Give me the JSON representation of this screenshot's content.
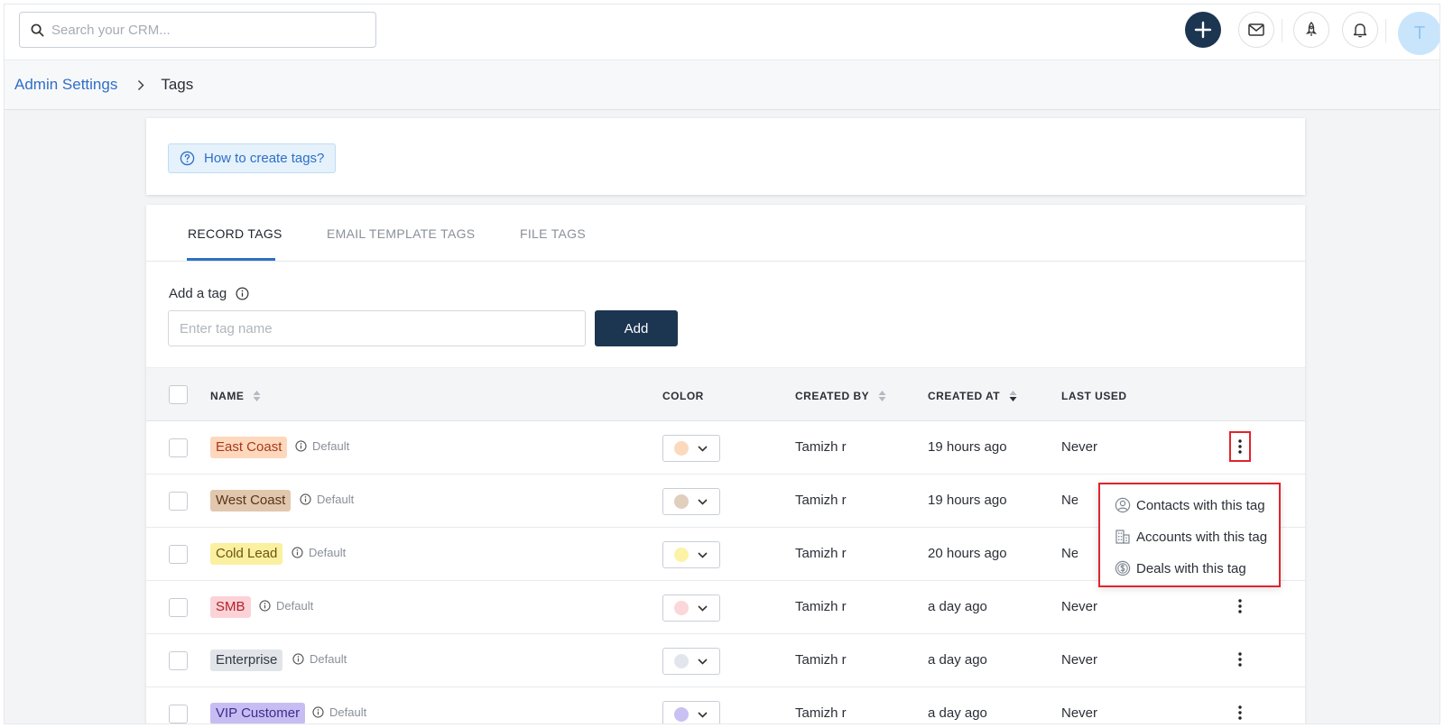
{
  "search": {
    "placeholder": "Search your CRM..."
  },
  "header": {
    "avatar_initial": "T"
  },
  "breadcrumb": {
    "parent": "Admin Settings",
    "current": "Tags"
  },
  "help": {
    "label": "How to create tags?"
  },
  "tabs": [
    {
      "label": "RECORD TAGS",
      "active": true
    },
    {
      "label": "EMAIL TEMPLATE TAGS",
      "active": false
    },
    {
      "label": "FILE TAGS",
      "active": false
    }
  ],
  "add_tag": {
    "label": "Add a tag",
    "placeholder": "Enter tag name",
    "button": "Add"
  },
  "table": {
    "headers": {
      "name": "NAME",
      "color": "COLOR",
      "created_by": "CREATED BY",
      "created_at": "CREATED AT",
      "last_used": "LAST USED"
    },
    "rows": [
      {
        "name": "East Coast",
        "badge": "Default",
        "chip_bg": "#fdd8bd",
        "chip_fg": "#a6391d",
        "swatch": "#fcd9bd",
        "created_by": "Tamizh r",
        "created_at": "19 hours ago",
        "last_used": "Never"
      },
      {
        "name": "West Coast",
        "badge": "Default",
        "chip_bg": "#e0c7ad",
        "chip_fg": "#5a3519",
        "swatch": "#e1cfbd",
        "created_by": "Tamizh r",
        "created_at": "19 hours ago",
        "last_used": "Ne"
      },
      {
        "name": "Cold Lead",
        "badge": "Default",
        "chip_bg": "#fbf0a0",
        "chip_fg": "#6b5512",
        "swatch": "#fcf3a6",
        "created_by": "Tamizh r",
        "created_at": "20 hours ago",
        "last_used": "Ne"
      },
      {
        "name": "SMB",
        "badge": "Default",
        "chip_bg": "#fbd3d7",
        "chip_fg": "#b0202c",
        "swatch": "#fbd6da",
        "created_by": "Tamizh r",
        "created_at": "a day ago",
        "last_used": "Never"
      },
      {
        "name": "Enterprise",
        "badge": "Default",
        "chip_bg": "#e1e4e9",
        "chip_fg": "#333a44",
        "swatch": "#e2e6ec",
        "created_by": "Tamizh r",
        "created_at": "a day ago",
        "last_used": "Never"
      },
      {
        "name": "VIP Customer",
        "badge": "Default",
        "chip_bg": "#c7bdf3",
        "chip_fg": "#3b2d8c",
        "swatch": "#c9c1f2",
        "created_by": "Tamizh r",
        "created_at": "a day ago",
        "last_used": "Never"
      }
    ]
  },
  "row_menu": {
    "items": [
      {
        "label": "Contacts with this tag",
        "icon": "contact-icon"
      },
      {
        "label": "Accounts with this tag",
        "icon": "building-icon"
      },
      {
        "label": "Deals with this tag",
        "icon": "dollar-coin-icon"
      }
    ]
  },
  "colors": {
    "accent": "#2e6fc6",
    "primary_dark": "#1c3550",
    "highlight": "#e0242b"
  }
}
